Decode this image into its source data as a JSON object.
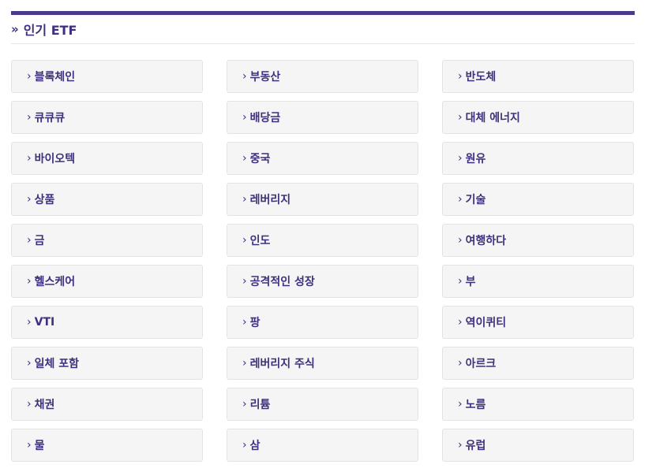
{
  "section": {
    "title_prefix": "»",
    "title": "인기 ETF"
  },
  "items": [
    "블록체인",
    "부동산",
    "반도체",
    "큐큐큐",
    "배당금",
    "대체 에너지",
    "바이오텍",
    "중국",
    "원유",
    "상품",
    "레버리지",
    "기술",
    "금",
    "인도",
    "여행하다",
    "헬스케어",
    "공격적인 성장",
    "부",
    "VTI",
    "팡",
    "역이퀴티",
    "일체 포함",
    "레버리지 주식",
    "아르크",
    "채권",
    "리튬",
    "노름",
    "물",
    "삼",
    "유럽"
  ],
  "chevron": "›",
  "colors": {
    "accent": "#4b3a8a",
    "tile_bg": "#f5f5f5"
  }
}
